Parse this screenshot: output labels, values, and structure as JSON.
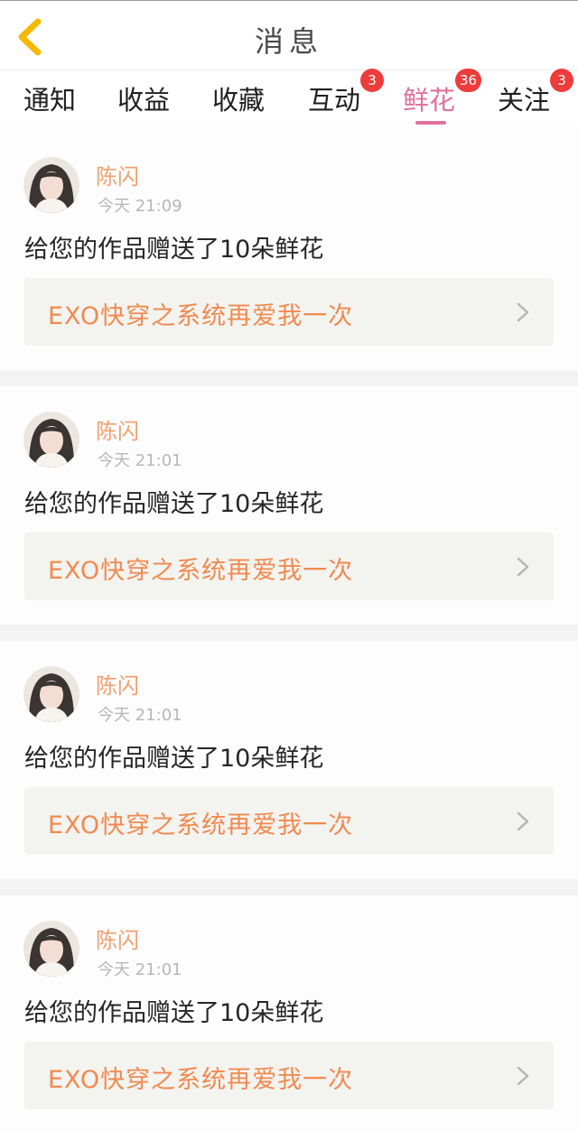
{
  "header": {
    "title": "消息",
    "back_icon": "chevron-left-icon",
    "back_icon_color": "#f5b800"
  },
  "tabs": [
    {
      "label": "通知",
      "badge": null
    },
    {
      "label": "收益",
      "badge": null
    },
    {
      "label": "收藏",
      "badge": null
    },
    {
      "label": "互动",
      "badge": "3"
    },
    {
      "label": "鲜花",
      "badge": "36",
      "active": true
    },
    {
      "label": "关注",
      "badge": "3"
    }
  ],
  "colors": {
    "accent": "#e0719c",
    "badge": "#ee3b3b",
    "username": "#f0a070",
    "work_title": "#f08a50"
  },
  "messages": [
    {
      "user": "陈闪",
      "time": "今天  21:09",
      "text": "给您的作品赠送了10朵鲜花",
      "work_title": "EXO快穿之系统再爱我一次"
    },
    {
      "user": "陈闪",
      "time": "今天  21:01",
      "text": "给您的作品赠送了10朵鲜花",
      "work_title": "EXO快穿之系统再爱我一次"
    },
    {
      "user": "陈闪",
      "time": "今天  21:01",
      "text": "给您的作品赠送了10朵鲜花",
      "work_title": "EXO快穿之系统再爱我一次"
    },
    {
      "user": "陈闪",
      "time": "今天  21:01",
      "text": "给您的作品赠送了10朵鲜花",
      "work_title": "EXO快穿之系统再爱我一次"
    }
  ]
}
